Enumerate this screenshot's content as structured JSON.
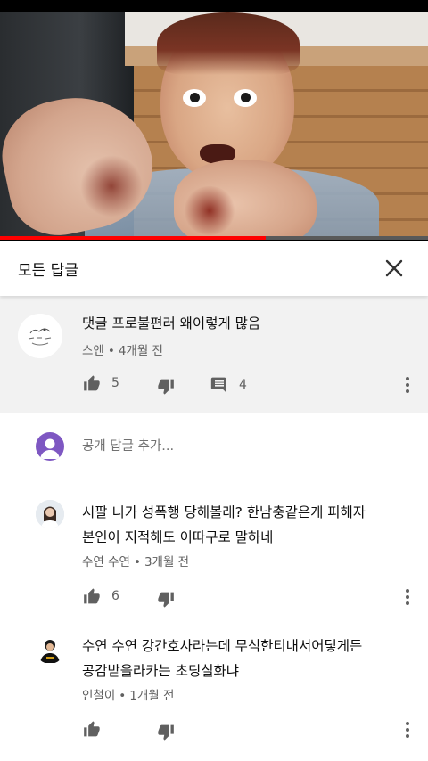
{
  "video": {
    "progress_fraction": 0.62
  },
  "panel": {
    "title": "모든 답글",
    "close_icon": "close-icon"
  },
  "parent_comment": {
    "text": "댓글 프로불편러 왜이렇게 많음",
    "author": "스엔",
    "age": "4개월 전",
    "likes": "5",
    "replies": "4"
  },
  "reply_box": {
    "placeholder": "공개 답글 추가..."
  },
  "replies": [
    {
      "line1": "시팔 니가 성폭행 당해볼래? 한남충같은게 피해자",
      "line2": "본인이 지적해도 이따구로 말하네",
      "author": "수연 수연",
      "age": "3개월 전",
      "likes": "6"
    },
    {
      "line1": "수연 수연 강간호사라는데 무식한티내서어덯게든",
      "line2": "공감받을라카는 초딩실화냐",
      "author": "인철이",
      "age": "1개월 전",
      "likes": ""
    }
  ],
  "meta_separator": "•",
  "colors": {
    "accent": "#ff0000",
    "reply_avatar": "#7e57c2",
    "highlight_bg": "#f2f2f2",
    "meta": "#606060"
  }
}
